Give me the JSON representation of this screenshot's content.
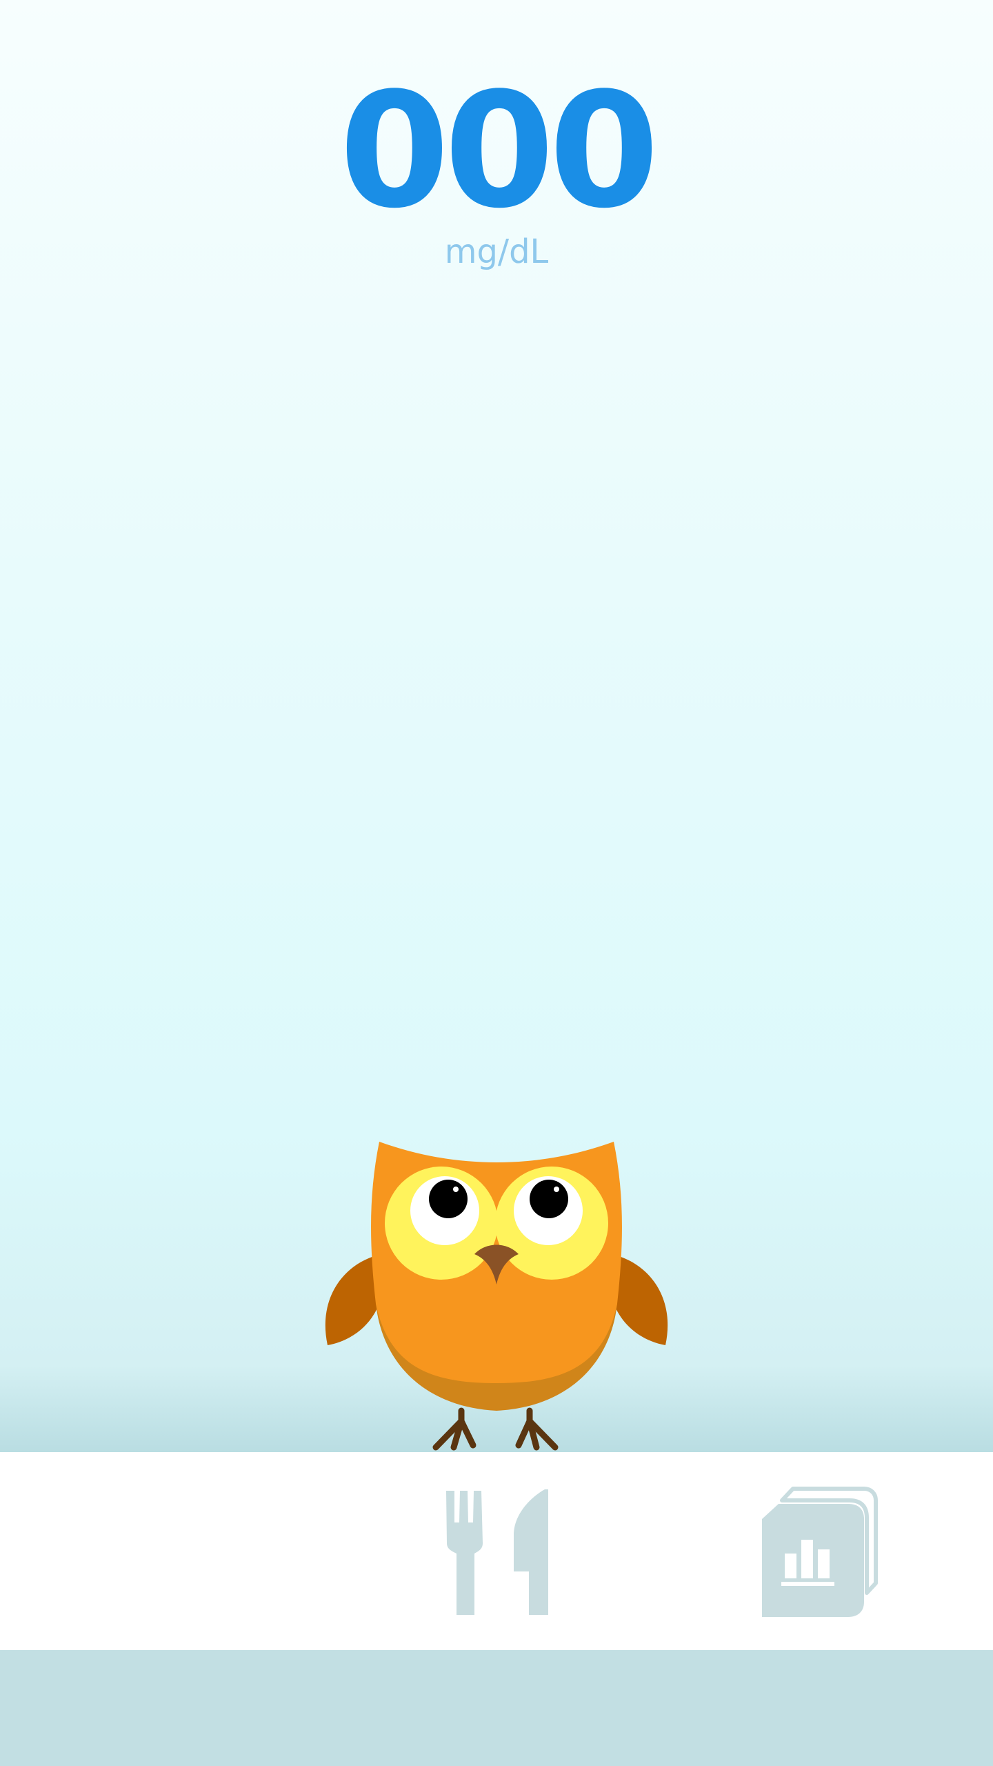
{
  "reading": {
    "value": "000",
    "unit": "mg/dL"
  },
  "colors": {
    "accent": "#1a8ee6",
    "unit_text": "#8ec8ec",
    "owl_body": "#f7961e",
    "owl_wing": "#bd6402",
    "owl_eye_ring": "#fff35c",
    "tab_icon": "#c8dcdf"
  },
  "mascot": {
    "icon": "owl-mascot"
  },
  "bottom_nav": {
    "tabs": [
      {
        "icon": "fork-knife-icon"
      },
      {
        "icon": "report-chart-icon"
      }
    ]
  }
}
